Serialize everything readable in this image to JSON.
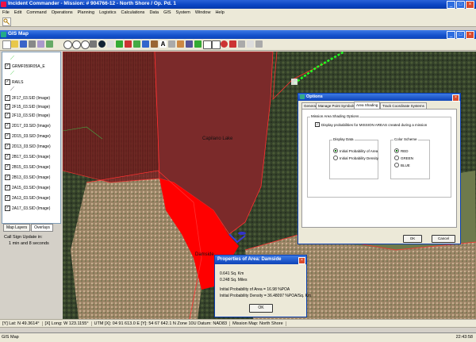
{
  "app": {
    "title": "Incident Commander - Mission: # 904766-12 - North Shore / Op. Pd. 1"
  },
  "menu": [
    "File",
    "Edit",
    "Command",
    "Operations",
    "Planning",
    "Logistics",
    "Calculations",
    "Data",
    "GIS",
    "System",
    "Window",
    "Help"
  ],
  "gis_window": {
    "title": "GIS Map"
  },
  "layers": {
    "items": [
      {
        "label": "GRMF059R05A_E",
        "checked": true
      },
      {
        "label": "RAILS",
        "checked": true
      },
      {
        "label": "2F17_03.SID (Image)",
        "checked": true
      },
      {
        "label": "2F15_03.SID (Image)",
        "checked": true
      },
      {
        "label": "2F13_03.SID (Image)",
        "checked": true
      },
      {
        "label": "2D17_03.SID (Image)",
        "checked": true
      },
      {
        "label": "2D15_03.SID (Image)",
        "checked": true
      },
      {
        "label": "2D13_03.SID (Image)",
        "checked": true
      },
      {
        "label": "2B17_03.SID (Image)",
        "checked": true
      },
      {
        "label": "2B15_03.SID (Image)",
        "checked": true
      },
      {
        "label": "2B13_03.SID (Image)",
        "checked": true
      },
      {
        "label": "2A15_03.SID (Image)",
        "checked": true
      },
      {
        "label": "2A13_03.SID (Image)",
        "checked": true
      },
      {
        "label": "2A17_03.SID (Image)",
        "checked": true
      }
    ]
  },
  "panel_tabs": [
    "Map Layers",
    "Overlays"
  ],
  "callsign": {
    "line1": "Call Sign Update in:",
    "line2": "1 min and 8 seconds"
  },
  "map": {
    "labels": {
      "capilano": "Capilano Lake",
      "damside": "Damside"
    },
    "colors": {
      "search_area_dark": "#7a1a1a",
      "search_area_red": "#ff0000",
      "terrain_green": "#3d4a2a",
      "urban": "#a58a6a"
    }
  },
  "options_dialog": {
    "title": "Options",
    "tabs": [
      "General",
      "Manage Point Symbols",
      "Area Shading",
      "Track Coordinate Systems"
    ],
    "active_tab": "Area Shading",
    "group_title": "Mission Area Shading Options",
    "checkbox_label": "Display probabilities for MISSION AREAS created during a mission",
    "display_data": {
      "title": "Display Data",
      "options": [
        "Initial Probability of Area",
        "Initial Probability Density"
      ],
      "selected": "Initial Probability of Area"
    },
    "color_scheme": {
      "title": "Color Scheme",
      "options": [
        "RED",
        "GREEN",
        "BLUE"
      ],
      "selected": "RED"
    },
    "ok_label": "OK",
    "cancel_label": "Cancel"
  },
  "props_dialog": {
    "title": "Properties of Area:  Damside",
    "area_km": "0.641 Sq. Km",
    "area_mi": "0.248 Sq. Miles",
    "poa": "Initial Probability of Area = 16.98 %POA",
    "pod": "Initial Probability Density = 36.48097 %POA/Sq. Km",
    "ok_label": "OK"
  },
  "status": {
    "lat": "[Y] Lat: N 49.3614°",
    "long": "[X] Long: W 123.1155°",
    "utm": "UTM [X]: 04 91 613.0 E  [Y]: 54 67 642.1 N   Zone 10U  Datum: NAD83",
    "map_name": "Mission Map: North Shore"
  },
  "taskbar": {
    "left": "GIS Map",
    "clock": "22:43:58"
  }
}
